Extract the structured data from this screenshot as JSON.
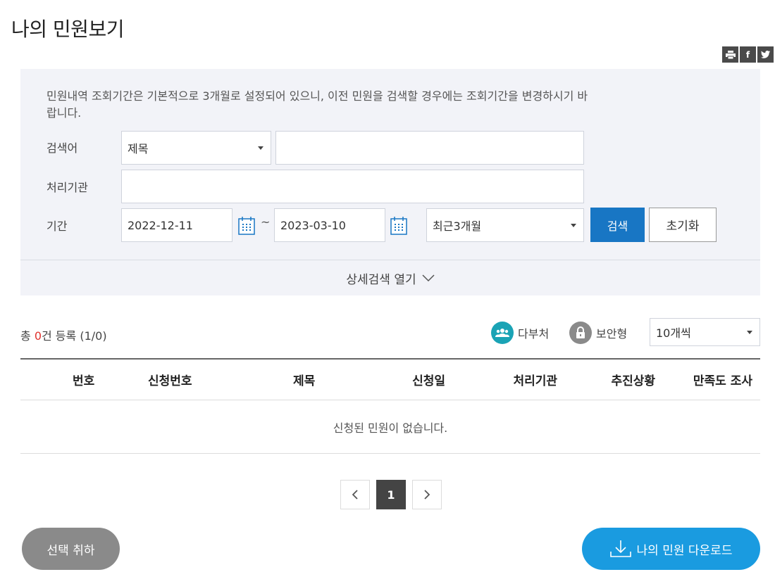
{
  "page": {
    "title": "나의 민원보기"
  },
  "share": {
    "print_icon": "printer-icon",
    "facebook_icon": "facebook-icon",
    "twitter_icon": "twitter-icon"
  },
  "search": {
    "description": "민원내역 조회기간은 기본적으로 3개월로 설정되어 있으니, 이전 민원을 검색할 경우에는 조회기간을 변경하시기 바랍니다.",
    "keyword_label": "검색어",
    "keyword_type": "제목",
    "keyword_value": "",
    "agency_label": "처리기관",
    "agency_value": "",
    "period_label": "기간",
    "start_date": "2022-12-11",
    "tilde": "~",
    "end_date": "2023-03-10",
    "period_preset": "최근3개월",
    "search_button": "검색",
    "reset_button": "초기화",
    "detail_toggle": "상세검색 열기"
  },
  "summary": {
    "prefix": "총 ",
    "count": "0",
    "suffix": "건 등록 (1/0)",
    "legend_multi": "다부처",
    "legend_secure": "보안형",
    "page_size": "10개씩"
  },
  "table": {
    "columns": [
      "번호",
      "신청번호",
      "제목",
      "신청일",
      "처리기관",
      "추진상황",
      "만족도 조사"
    ],
    "empty_message": "신청된 민원이 없습니다."
  },
  "pagination": {
    "prev": "‹",
    "current": "1",
    "next": "›"
  },
  "actions": {
    "deselect": "선택 취하",
    "download": "나의 민원 다운로드"
  },
  "colors": {
    "primary": "#1876c4",
    "download": "#1a9be0",
    "accent_count": "#e0332e",
    "legend_multi": "#1aa3b5",
    "legend_secure": "#8a8a8a"
  }
}
